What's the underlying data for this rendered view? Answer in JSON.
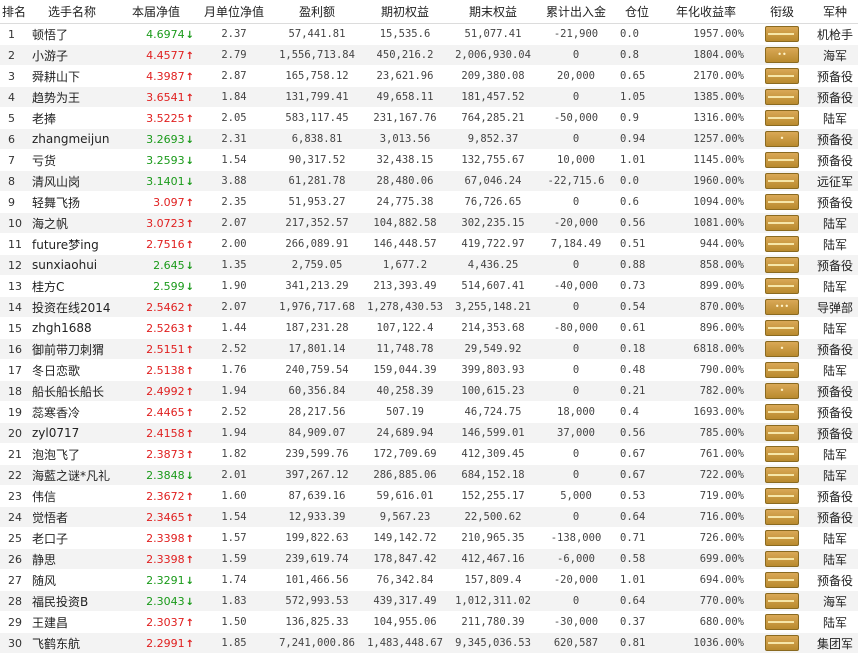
{
  "headers": [
    "排名",
    "选手名称",
    "本届净值",
    "月单位净值",
    "盈利额",
    "期初权益",
    "期末权益",
    "累计出入金",
    "仓位",
    "年化收益率",
    "衔级",
    "军种"
  ],
  "rows": [
    {
      "rank": "1",
      "name": "顿悟了",
      "nav": "4.6974",
      "dir": "down",
      "month": "2.37",
      "profit": "57,441.81",
      "start": "15,535.6",
      "end": "51,077.41",
      "flow": "-21,900",
      "pos": "0.0",
      "rate": "1957.00%",
      "badge": "",
      "army": "机枪手"
    },
    {
      "rank": "2",
      "name": "小游子",
      "nav": "4.4577",
      "dir": "up",
      "month": "2.79",
      "profit": "1,556,713.84",
      "start": "450,216.2",
      "end": "2,006,930.04",
      "flow": "0",
      "pos": "0.8",
      "rate": "1804.00%",
      "badge": "••",
      "army": "海军"
    },
    {
      "rank": "3",
      "name": "舜耕山下",
      "nav": "4.3987",
      "dir": "up",
      "month": "2.87",
      "profit": "165,758.12",
      "start": "23,621.96",
      "end": "209,380.08",
      "flow": "20,000",
      "pos": "0.65",
      "rate": "2170.00%",
      "badge": "",
      "army": "预备役"
    },
    {
      "rank": "4",
      "name": "趋势为王",
      "nav": "3.6541",
      "dir": "up",
      "month": "1.84",
      "profit": "131,799.41",
      "start": "49,658.11",
      "end": "181,457.52",
      "flow": "0",
      "pos": "1.05",
      "rate": "1385.00%",
      "badge": "",
      "army": "预备役"
    },
    {
      "rank": "5",
      "name": "老捧",
      "nav": "3.5225",
      "dir": "up",
      "month": "2.05",
      "profit": "583,117.45",
      "start": "231,167.76",
      "end": "764,285.21",
      "flow": "-50,000",
      "pos": "0.9",
      "rate": "1316.00%",
      "badge": "",
      "army": "陆军"
    },
    {
      "rank": "6",
      "name": "zhangmeijun",
      "nav": "3.2693",
      "dir": "down",
      "month": "2.31",
      "profit": "6,838.81",
      "start": "3,013.56",
      "end": "9,852.37",
      "flow": "0",
      "pos": "0.94",
      "rate": "1257.00%",
      "badge": "•",
      "army": "预备役"
    },
    {
      "rank": "7",
      "name": "亏货",
      "nav": "3.2593",
      "dir": "down",
      "month": "1.54",
      "profit": "90,317.52",
      "start": "32,438.15",
      "end": "132,755.67",
      "flow": "10,000",
      "pos": "1.01",
      "rate": "1145.00%",
      "badge": "",
      "army": "预备役"
    },
    {
      "rank": "8",
      "name": "清风山岗",
      "nav": "3.1401",
      "dir": "down",
      "month": "3.88",
      "profit": "61,281.78",
      "start": "28,480.06",
      "end": "67,046.24",
      "flow": "-22,715.6",
      "pos": "0.0",
      "rate": "1960.00%",
      "badge": "",
      "army": "远征军"
    },
    {
      "rank": "9",
      "name": "轻舞飞扬",
      "nav": "3.097",
      "dir": "up",
      "month": "2.35",
      "profit": "51,953.27",
      "start": "24,775.38",
      "end": "76,726.65",
      "flow": "0",
      "pos": "0.6",
      "rate": "1094.00%",
      "badge": "",
      "army": "预备役"
    },
    {
      "rank": "10",
      "name": "海之帆",
      "nav": "3.0723",
      "dir": "up",
      "month": "2.07",
      "profit": "217,352.57",
      "start": "104,882.58",
      "end": "302,235.15",
      "flow": "-20,000",
      "pos": "0.56",
      "rate": "1081.00%",
      "badge": "",
      "army": "陆军"
    },
    {
      "rank": "11",
      "name": "future梦ing",
      "nav": "2.7516",
      "dir": "up",
      "month": "2.00",
      "profit": "266,089.91",
      "start": "146,448.57",
      "end": "419,722.97",
      "flow": "7,184.49",
      "pos": "0.51",
      "rate": "944.00%",
      "badge": "",
      "army": "陆军"
    },
    {
      "rank": "12",
      "name": "sunxiaohui",
      "nav": "2.645",
      "dir": "down",
      "month": "1.35",
      "profit": "2,759.05",
      "start": "1,677.2",
      "end": "4,436.25",
      "flow": "0",
      "pos": "0.88",
      "rate": "858.00%",
      "badge": "",
      "army": "预备役"
    },
    {
      "rank": "13",
      "name": "桂方C",
      "nav": "2.599",
      "dir": "down",
      "month": "1.90",
      "profit": "341,213.29",
      "start": "213,393.49",
      "end": "514,607.41",
      "flow": "-40,000",
      "pos": "0.73",
      "rate": "899.00%",
      "badge": "",
      "army": "陆军"
    },
    {
      "rank": "14",
      "name": "投资在线2014",
      "nav": "2.5462",
      "dir": "up",
      "month": "2.07",
      "profit": "1,976,717.68",
      "start": "1,278,430.53",
      "end": "3,255,148.21",
      "flow": "0",
      "pos": "0.54",
      "rate": "870.00%",
      "badge": "•••",
      "army": "导弹部"
    },
    {
      "rank": "15",
      "name": "zhgh1688",
      "nav": "2.5263",
      "dir": "up",
      "month": "1.44",
      "profit": "187,231.28",
      "start": "107,122.4",
      "end": "214,353.68",
      "flow": "-80,000",
      "pos": "0.61",
      "rate": "896.00%",
      "badge": "",
      "army": "陆军"
    },
    {
      "rank": "16",
      "name": "御前带刀刺猬",
      "nav": "2.5151",
      "dir": "up",
      "month": "2.52",
      "profit": "17,801.14",
      "start": "11,748.78",
      "end": "29,549.92",
      "flow": "0",
      "pos": "0.18",
      "rate": "6818.00%",
      "badge": "•",
      "army": "预备役"
    },
    {
      "rank": "17",
      "name": "冬日恋歌",
      "nav": "2.5138",
      "dir": "up",
      "month": "1.76",
      "profit": "240,759.54",
      "start": "159,044.39",
      "end": "399,803.93",
      "flow": "0",
      "pos": "0.48",
      "rate": "790.00%",
      "badge": "",
      "army": "陆军"
    },
    {
      "rank": "18",
      "name": "船长船长船长",
      "nav": "2.4992",
      "dir": "up",
      "month": "1.94",
      "profit": "60,356.84",
      "start": "40,258.39",
      "end": "100,615.23",
      "flow": "0",
      "pos": "0.21",
      "rate": "782.00%",
      "badge": "•",
      "army": "预备役"
    },
    {
      "rank": "19",
      "name": "蕊寒香冷",
      "nav": "2.4465",
      "dir": "up",
      "month": "2.52",
      "profit": "28,217.56",
      "start": "507.19",
      "end": "46,724.75",
      "flow": "18,000",
      "pos": "0.4",
      "rate": "1693.00%",
      "badge": "",
      "army": "预备役"
    },
    {
      "rank": "20",
      "name": "zyl0717",
      "nav": "2.4158",
      "dir": "up",
      "month": "1.94",
      "profit": "84,909.07",
      "start": "24,689.94",
      "end": "146,599.01",
      "flow": "37,000",
      "pos": "0.56",
      "rate": "785.00%",
      "badge": "",
      "army": "预备役"
    },
    {
      "rank": "21",
      "name": "泡泡飞了",
      "nav": "2.3873",
      "dir": "up",
      "month": "1.82",
      "profit": "239,599.76",
      "start": "172,709.69",
      "end": "412,309.45",
      "flow": "0",
      "pos": "0.67",
      "rate": "761.00%",
      "badge": "",
      "army": "陆军"
    },
    {
      "rank": "22",
      "name": "海藍之谜*凡礼",
      "nav": "2.3848",
      "dir": "down",
      "month": "2.01",
      "profit": "397,267.12",
      "start": "286,885.06",
      "end": "684,152.18",
      "flow": "0",
      "pos": "0.67",
      "rate": "722.00%",
      "badge": "",
      "army": "陆军"
    },
    {
      "rank": "23",
      "name": "伟信",
      "nav": "2.3672",
      "dir": "up",
      "month": "1.60",
      "profit": "87,639.16",
      "start": "59,616.01",
      "end": "152,255.17",
      "flow": "5,000",
      "pos": "0.53",
      "rate": "719.00%",
      "badge": "",
      "army": "预备役"
    },
    {
      "rank": "24",
      "name": "觉悟者",
      "nav": "2.3465",
      "dir": "up",
      "month": "1.54",
      "profit": "12,933.39",
      "start": "9,567.23",
      "end": "22,500.62",
      "flow": "0",
      "pos": "0.64",
      "rate": "716.00%",
      "badge": "",
      "army": "预备役"
    },
    {
      "rank": "25",
      "name": "老口子",
      "nav": "2.3398",
      "dir": "up",
      "month": "1.57",
      "profit": "199,822.63",
      "start": "149,142.72",
      "end": "210,965.35",
      "flow": "-138,000",
      "pos": "0.71",
      "rate": "726.00%",
      "badge": "",
      "army": "陆军"
    },
    {
      "rank": "26",
      "name": "静思",
      "nav": "2.3398",
      "dir": "up",
      "month": "1.59",
      "profit": "239,619.74",
      "start": "178,847.42",
      "end": "412,467.16",
      "flow": "-6,000",
      "pos": "0.58",
      "rate": "699.00%",
      "badge": "",
      "army": "陆军"
    },
    {
      "rank": "27",
      "name": "随风",
      "nav": "2.3291",
      "dir": "down",
      "month": "1.74",
      "profit": "101,466.56",
      "start": "76,342.84",
      "end": "157,809.4",
      "flow": "-20,000",
      "pos": "1.01",
      "rate": "694.00%",
      "badge": "",
      "army": "预备役"
    },
    {
      "rank": "28",
      "name": "福民投资B",
      "nav": "2.3043",
      "dir": "down",
      "month": "1.83",
      "profit": "572,993.53",
      "start": "439,317.49",
      "end": "1,012,311.02",
      "flow": "0",
      "pos": "0.64",
      "rate": "770.00%",
      "badge": "",
      "army": "海军"
    },
    {
      "rank": "29",
      "name": "王建昌",
      "nav": "2.3037",
      "dir": "up",
      "month": "1.50",
      "profit": "136,825.33",
      "start": "104,955.06",
      "end": "211,780.39",
      "flow": "-30,000",
      "pos": "0.37",
      "rate": "680.00%",
      "badge": "",
      "army": "陆军"
    },
    {
      "rank": "30",
      "name": "飞鹤东航",
      "nav": "2.2991",
      "dir": "up",
      "month": "1.85",
      "profit": "7,241,000.86",
      "start": "1,483,448.67",
      "end": "9,345,036.53",
      "flow": "620,587",
      "pos": "0.81",
      "rate": "1036.00%",
      "badge": "",
      "army": "集团军"
    }
  ],
  "icons": {
    "up": "arrow-up-icon",
    "down": "arrow-down-icon",
    "badge": "rank-insignia-icon"
  },
  "colors": {
    "up": "#e02020",
    "down": "#1a9a1a",
    "badge": "#c9983e"
  }
}
